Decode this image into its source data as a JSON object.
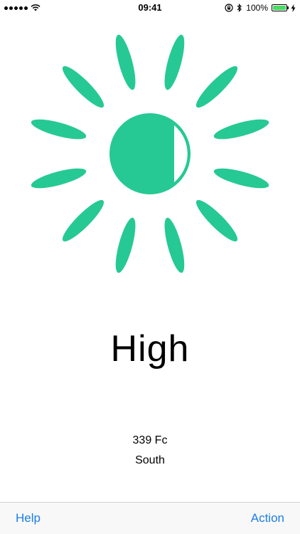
{
  "status_bar": {
    "time": "09:41",
    "battery_percent": "100%"
  },
  "main": {
    "light_level": "High",
    "reading": "339 Fc",
    "direction": "South"
  },
  "toolbar": {
    "help_label": "Help",
    "action_label": "Action"
  },
  "colors": {
    "accent": "#26c993",
    "link": "#1a7ee8"
  }
}
